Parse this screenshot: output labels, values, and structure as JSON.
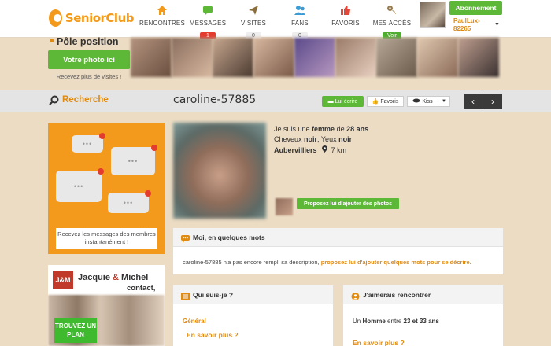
{
  "logo": {
    "text": "SeniorClub"
  },
  "nav": [
    {
      "label": "RENCONTRES",
      "badge": "",
      "icon": "home-icon",
      "color": "#f39a1d"
    },
    {
      "label": "MESSAGES",
      "badge": "1",
      "icon": "chat-icon",
      "color": "#5cb836"
    },
    {
      "label": "VISITES",
      "badge": "0",
      "icon": "paper-plane-icon",
      "color": "#8a6d3b"
    },
    {
      "label": "FANS",
      "badge": "0",
      "icon": "users-icon",
      "color": "#3b9dd6"
    },
    {
      "label": "FAVORIS",
      "badge": "",
      "icon": "thumbs-up-icon",
      "color": "#e2473b"
    },
    {
      "label": "MES ACCÈS",
      "badge": "Voir",
      "icon": "key-icon",
      "color": "#9a7b4f"
    }
  ],
  "user": {
    "subscribe_label": "Abonnement",
    "username": "PaulLux-82265"
  },
  "pole": {
    "title": "Pôle position",
    "button": "Votre photo ici",
    "subtitle": "Recevez plus de visites !"
  },
  "search": {
    "label": "Recherche"
  },
  "profile": {
    "name": "caroline-57885",
    "actions": {
      "write": "Lui écrire",
      "favoris": "Favoris",
      "kiss": "Kiss"
    },
    "intro_prefix": "Je suis une",
    "gender": "femme",
    "intro_mid": "de",
    "age": "28 ans",
    "hair_prefix": "Cheveux",
    "hair": "noir",
    "eyes_prefix": ", Yeux",
    "eyes": "noir",
    "city": "Aubervilliers",
    "distance": "7 km",
    "add_photos": "Proposez lui d'ajouter des photos"
  },
  "description": {
    "title": "Moi, en quelques mots",
    "text": "caroline-57885 n'a pas encore rempli sa description,",
    "link": "proposez lui d'ajouter quelques mots pour se décrire."
  },
  "who": {
    "title": "Qui suis-je ?",
    "section": "Général",
    "more": "En savoir plus ?"
  },
  "meet": {
    "title": "J'aimerais rencontrer",
    "prefix": "Un",
    "gender": "Homme",
    "mid": "entre",
    "range": "23 et 33 ans",
    "more": "En savoir plus ?"
  },
  "ads": {
    "messages_text": "Recevez les messages des membres instantanément !",
    "jm_logo": "J&M",
    "jm_name1": "Jacquie",
    "jm_amp": "&",
    "jm_name2": "Michel",
    "jm_sub": "contact,",
    "jm_button": "TROUVEZ UN PLAN"
  }
}
